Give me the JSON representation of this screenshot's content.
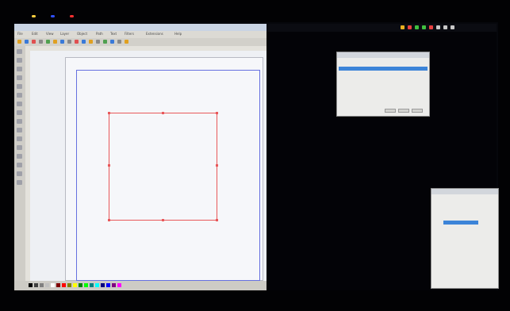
{
  "desktop": {
    "tray_colors": [
      "#e8b020",
      "#e84040",
      "#40c040",
      "#40c040",
      "#e84040",
      "#c8c8c8",
      "#c8c8c8",
      "#c8c8c8"
    ],
    "top_leds": [
      "#ffd040",
      "#3050ff",
      "#ff3030"
    ]
  },
  "editor": {
    "menu": [
      "File",
      "Edit",
      "View",
      "Layer",
      "Object",
      "Path",
      "Text",
      "Filters",
      "Extensions",
      "Help"
    ],
    "tool_icons": [
      "select-icon",
      "node-icon",
      "tweak-icon",
      "zoom-icon",
      "rect-icon",
      "ellipse-icon",
      "star-icon",
      "spiral-icon",
      "pencil-icon",
      "pen-icon",
      "calligraphy-icon",
      "text-icon",
      "gradient-icon",
      "dropper-icon",
      "paint-bucket-icon",
      "eraser-icon"
    ],
    "toolbar_colors": [
      "#e0a020",
      "#3a7ad8",
      "#e05050",
      "#8a8a8a",
      "#50a050",
      "#e0a020",
      "#3a7ad8",
      "#8a8a8a",
      "#e05050",
      "#3a7ad8",
      "#e0a020",
      "#8a8a8a",
      "#50a050",
      "#3a7ad8",
      "#8a8a8a",
      "#e0a020"
    ],
    "selection_color": "#e8585a",
    "page_border_color": "#6670e0",
    "palette": [
      "#000000",
      "#404040",
      "#808080",
      "#c0c0c0",
      "#ffffff",
      "#800000",
      "#ff0000",
      "#808000",
      "#ffff00",
      "#008000",
      "#00ff00",
      "#008080",
      "#00ffff",
      "#000080",
      "#0000ff",
      "#800080",
      "#ff00ff"
    ],
    "status_text": ""
  },
  "terminal": {
    "text_color": "#c8c8e8",
    "highlight_color": "#e84040",
    "lines": [
      "",
      "",
      "",
      "",
      "",
      "",
      "",
      "",
      "",
      "",
      "",
      "",
      "",
      "",
      "",
      "",
      "",
      "",
      "",
      "",
      "",
      "",
      "",
      "",
      "",
      "",
      "",
      "",
      ""
    ]
  },
  "dialog_top": {
    "title": "",
    "rows": [
      {
        "label": "",
        "selected": true
      },
      {
        "label": "",
        "selected": false
      },
      {
        "label": "",
        "selected": false
      }
    ],
    "buttons": [
      "",
      "",
      ""
    ]
  },
  "dialog_bottom": {
    "title": "",
    "rows": [
      {
        "label": "",
        "selected": false
      },
      {
        "label": "",
        "selected": false
      },
      {
        "label": "",
        "selected": false
      },
      {
        "label": "",
        "selected": true
      }
    ]
  }
}
